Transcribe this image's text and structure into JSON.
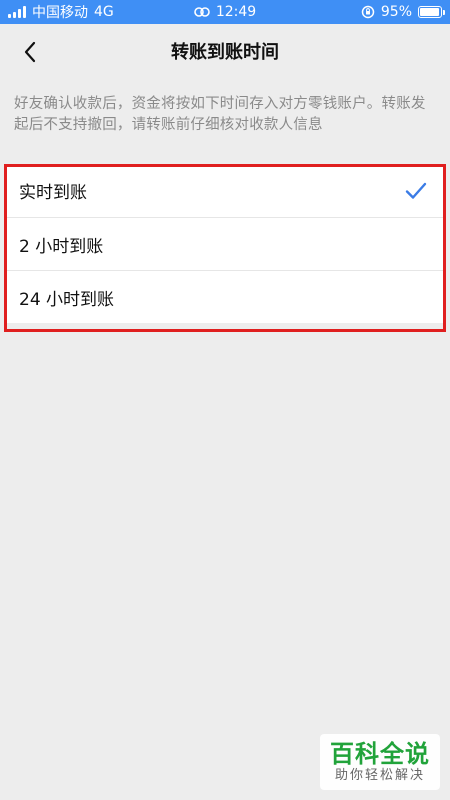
{
  "status_bar": {
    "carrier": "中国移动",
    "network": "4G",
    "time": "12:49",
    "battery": "95%",
    "battery_level": 0.95,
    "icons": [
      "signal-icon",
      "link-icon",
      "orientation-lock-icon",
      "battery-icon"
    ]
  },
  "nav": {
    "title": "转账到账时间",
    "back_icon": "chevron-left-icon"
  },
  "description": "好友确认收款后，资金将按如下时间存入对方零钱账户。转账发起后不支持撤回，请转账前仔细核对收款人信息",
  "options": [
    {
      "label": "实时到账",
      "selected": true
    },
    {
      "label": "2 小时到账",
      "selected": false
    },
    {
      "label": "24 小时到账",
      "selected": false
    }
  ],
  "colors": {
    "status_bar": "#3f8ff5",
    "accent": "#3b7ce6",
    "highlight": "#e01f1f",
    "watermark_green": "#21a33a"
  },
  "watermark": {
    "title": "百科全说",
    "subtitle": "助你轻松解决"
  }
}
